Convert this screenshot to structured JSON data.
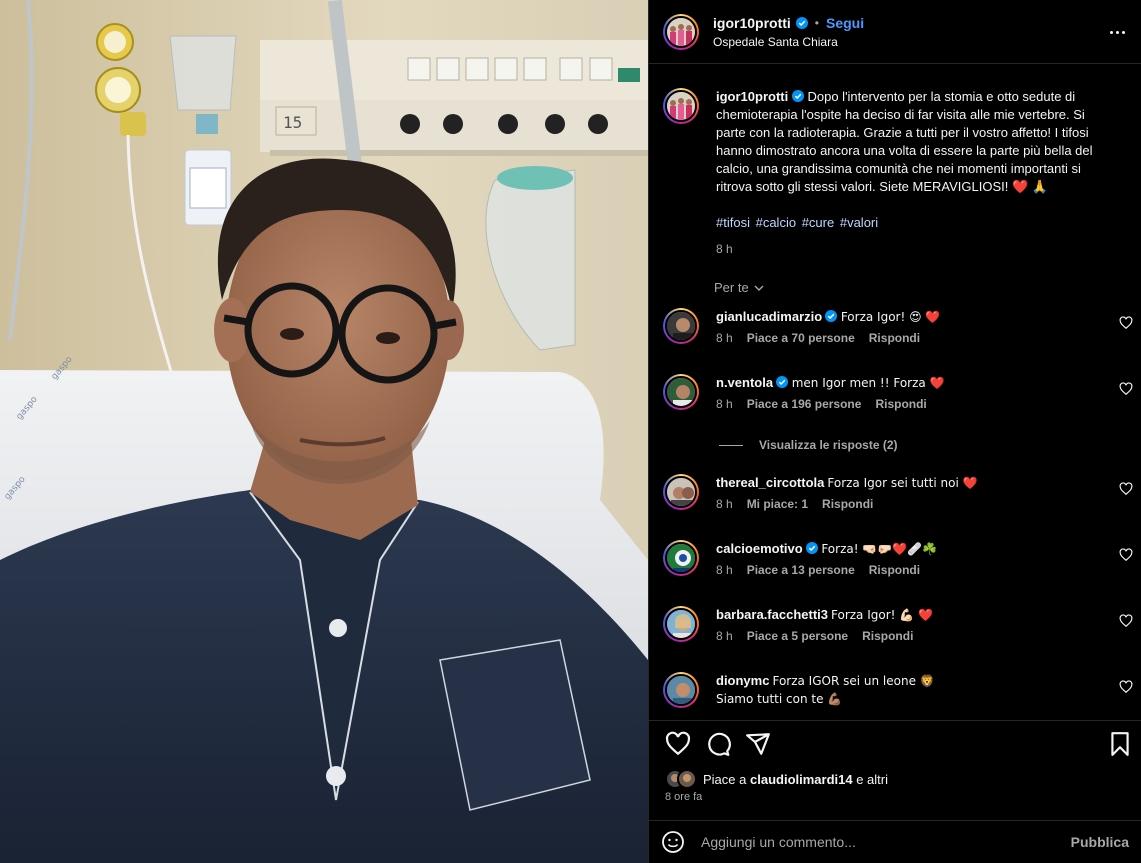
{
  "post": {
    "author": "igor10protti",
    "follow_label": "Segui",
    "dot": "•",
    "location": "Ospedale Santa Chiara",
    "more_icon": "more-horizontal-icon"
  },
  "caption": {
    "username": "igor10protti",
    "text": "Dopo l'intervento per la stomia e otto sedute di chemioterapia l'ospite ha deciso di far visita alle mie vertebre. Si parte con la radioterapia. Grazie a tutti per il vostro affetto! I tifosi hanno dimostrato ancora una volta di essere la parte più bella del calcio, una grandissima comunità che nei momenti importanti si ritrova sotto gli stessi valori. Siete MERAVIGLIOSI! ❤️ 🙏",
    "hashtags": [
      "#tifosi",
      "#calcio",
      "#cure",
      "#valori"
    ],
    "time": "8 h"
  },
  "sort_label": "Per te",
  "comments": [
    {
      "username": "gianlucadimarzio",
      "verified": true,
      "text": "Forza Igor! 😍 ❤️",
      "time": "8 h",
      "likes": "Piace a 70 persone",
      "reply": "Rispondi"
    },
    {
      "username": "n.ventola",
      "verified": true,
      "text": "men Igor men !! Forza ❤️",
      "time": "8 h",
      "likes": "Piace a 196 persone",
      "reply": "Rispondi"
    },
    {
      "username": "thereal_circottola",
      "verified": false,
      "text": "Forza Igor sei tutti noi ❤️",
      "time": "8 h",
      "likes": "Mi piace: 1",
      "reply": "Rispondi"
    },
    {
      "username": "calcioemotivo",
      "verified": true,
      "text": "Forza! 🤜🏻🤛🏻❤️🩹☘️",
      "time": "8 h",
      "likes": "Piace a 13 persone",
      "reply": "Rispondi"
    },
    {
      "username": "barbara.facchetti3",
      "verified": false,
      "text": "Forza Igor! 💪🏻 ❤️",
      "time": "8 h",
      "likes": "Piace a 5 persone",
      "reply": "Rispondi"
    },
    {
      "username": "dionymc",
      "verified": false,
      "text": "Forza IGOR sei un leone 🦁",
      "text2": "Siamo tutti con te 💪🏽",
      "time": "",
      "likes": "",
      "reply": ""
    }
  ],
  "view_replies": "Visualizza le risposte (2)",
  "liked_by": {
    "prefix": "Piace a",
    "user": "claudiolimardi14",
    "suffix": "e altri"
  },
  "post_time": "8 ore fa",
  "add_comment": {
    "placeholder": "Aggiungi un commento...",
    "publish": "Pubblica"
  },
  "colors": {
    "accent": "#0095f6",
    "verified": "#0095f6",
    "link": "#e0f1ff",
    "muted": "#a8a8a8"
  }
}
